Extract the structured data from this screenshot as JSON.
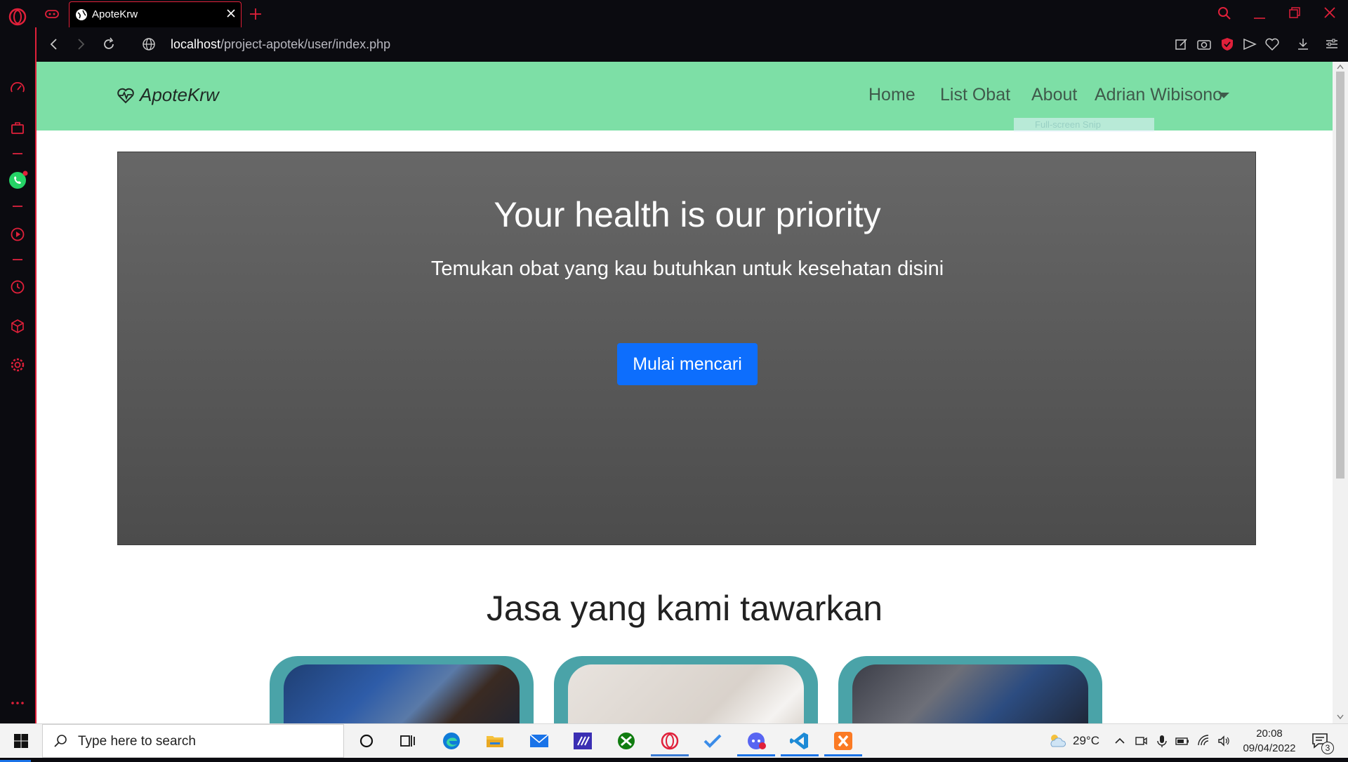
{
  "browser": {
    "tab_title": "ApoteKrw",
    "url_host": "localhost",
    "url_path": "/project-apotek/user/index.php",
    "accent_color": "#e0203a"
  },
  "navbar": {
    "brand": "ApoteKrw",
    "links": [
      "Home",
      "List Obat",
      "About"
    ],
    "user_menu": "Adrian Wibisono",
    "ghost_tooltip": "Full-screen Snip",
    "bg_color": "#7ddfa6"
  },
  "hero": {
    "title": "Your health is our priority",
    "subtitle": "Temukan obat yang kau butuhkan untuk kesehatan disini",
    "button": "Mulai mencari"
  },
  "services": {
    "title": "Jasa yang kami tawarkan",
    "card_color": "#4aa3a8"
  },
  "taskbar": {
    "search_placeholder": "Type here to search",
    "temperature": "29°C",
    "time": "20:08",
    "date": "09/04/2022",
    "notification_count": "3"
  }
}
